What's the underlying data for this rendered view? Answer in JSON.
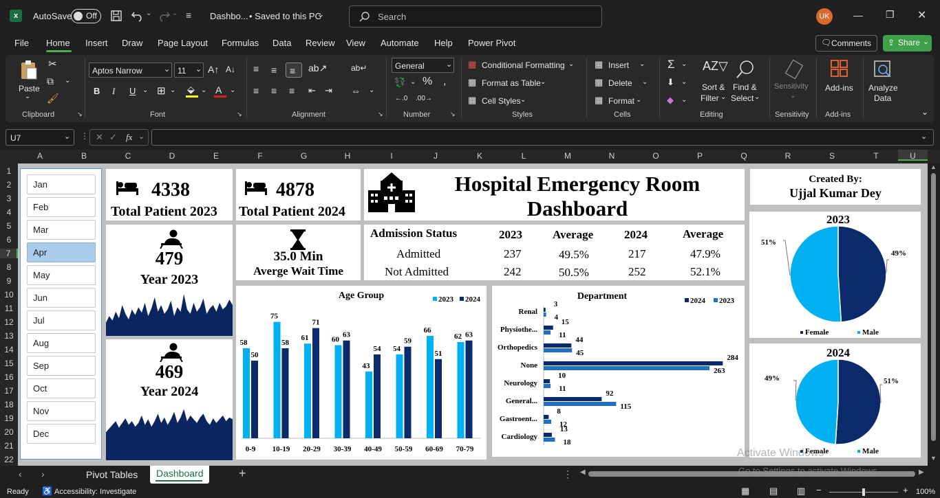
{
  "titlebar": {
    "autosave": "AutoSave",
    "toggle": "Off",
    "filename": "Dashbo...",
    "saved": "• Saved to this PC",
    "search_placeholder": "Search",
    "user": "UK"
  },
  "tabs": [
    "File",
    "Home",
    "Insert",
    "Draw",
    "Page Layout",
    "Formulas",
    "Data",
    "Review",
    "View",
    "Automate",
    "Help",
    "Power Pivot"
  ],
  "actions": {
    "comments": "Comments",
    "share": "Share"
  },
  "ribbon": {
    "paste": "Paste",
    "clipboard": "Clipboard",
    "font_name": "Aptos Narrow",
    "font_size": "11",
    "font": "Font",
    "alignment": "Alignment",
    "number_format": "General",
    "number": "Number",
    "cond_format": "Conditional Formatting",
    "format_table": "Format as Table",
    "cell_styles": "Cell Styles",
    "styles": "Styles",
    "insert": "Insert",
    "delete": "Delete",
    "format": "Format",
    "cells": "Cells",
    "sort_filter": "Sort &",
    "sort_filter2": "Filter",
    "find_select": "Find &",
    "find_select2": "Select",
    "editing": "Editing",
    "sensitivity": "Sensitivity",
    "sensitivity_grp": "Sensitivity",
    "addins": "Add-ins",
    "addins_grp": "Add-ins",
    "analyze": "Analyze",
    "analyze2": "Data"
  },
  "formula_bar": {
    "name_box": "U7",
    "fx": "fx",
    "formula": ""
  },
  "columns": [
    "A",
    "B",
    "C",
    "D",
    "E",
    "F",
    "G",
    "H",
    "I",
    "J",
    "K",
    "L",
    "M",
    "N",
    "O",
    "P",
    "Q",
    "R",
    "S",
    "T",
    "U"
  ],
  "rows": [
    "1",
    "2",
    "3",
    "4",
    "5",
    "6",
    "7",
    "8",
    "9",
    "10",
    "11",
    "12",
    "13",
    "14",
    "15",
    "16",
    "17",
    "18",
    "19",
    "20",
    "21",
    "22"
  ],
  "months": [
    "Jan",
    "Feb",
    "Mar",
    "Apr",
    "May",
    "Jun",
    "Jul",
    "Aug",
    "Sep",
    "Oct",
    "Nov",
    "Dec"
  ],
  "selected_month": "Apr",
  "kpi": {
    "p2023_value": "4338",
    "p2023_label": "Total Patient 2023",
    "p2024_value": "4878",
    "p2024_label": "Total Patient 2024",
    "wait_value": "35.0 Min",
    "wait_label": "Averge Wait Time",
    "y2023_value": "479",
    "y2023_label": "Year 2023",
    "y2024_value": "469",
    "y2024_label": "Year 2024"
  },
  "title": {
    "line1": "Hospital Emergency Room",
    "line2": "Dashboard"
  },
  "creator": {
    "line1": "Created By:",
    "line2": "Ujjal Kumar Dey"
  },
  "admission": {
    "headers": [
      "Admission Status",
      "2023",
      "Average",
      "2024",
      "Average"
    ],
    "rows": [
      [
        "Admitted",
        "237",
        "49.5%",
        "217",
        "47.9%"
      ],
      [
        "Not Admitted",
        "242",
        "50.5%",
        "252",
        "52.1%"
      ]
    ]
  },
  "sheet_tabs": [
    "Pivot Tables",
    "Dashboard"
  ],
  "active_sheet": "Dashboard",
  "status": {
    "ready": "Ready",
    "accessibility": "Accessibility: Investigate",
    "zoom": "100%"
  },
  "watermark": {
    "line1": "Activate Windows",
    "line2": "Go to Settings to activate Windows."
  },
  "colors": {
    "dark": "#0b2a6b",
    "light": "#00b0f0",
    "mid": "#1f6fc5",
    "selected": "#a9cdea",
    "share": "#4caf50"
  },
  "chart_data": [
    {
      "type": "bar",
      "title": "Age Group",
      "categories": [
        "0-9",
        "10-19",
        "20-29",
        "30-39",
        "40-49",
        "50-59",
        "60-69",
        "70-79"
      ],
      "series": [
        {
          "name": "2023",
          "values": [
            58,
            75,
            61,
            60,
            43,
            54,
            66,
            62
          ]
        },
        {
          "name": "2024",
          "values": [
            50,
            58,
            71,
            63,
            54,
            59,
            51,
            63
          ]
        }
      ],
      "ylim": [
        0,
        85
      ]
    },
    {
      "type": "bar",
      "orientation": "horizontal",
      "title": "Department",
      "categories": [
        "Renal",
        "Physiothe...",
        "Orthopedics",
        "None",
        "Neurology",
        "General...",
        "Gastroent...",
        "Cardiology"
      ],
      "series": [
        {
          "name": "2024",
          "values": [
            3,
            15,
            44,
            284,
            10,
            92,
            8,
            13
          ]
        },
        {
          "name": "2023",
          "values": [
            4,
            11,
            45,
            263,
            11,
            115,
            12,
            18
          ]
        }
      ],
      "xlim": [
        0,
        300
      ]
    },
    {
      "type": "pie",
      "title": "2023",
      "labels": [
        "Female",
        "Male"
      ],
      "values": [
        49,
        51
      ],
      "display": [
        "49%",
        "51%"
      ]
    },
    {
      "type": "pie",
      "title": "2024",
      "labels": [
        "Female",
        "Male"
      ],
      "values": [
        51,
        49
      ],
      "display": [
        "51%",
        "49%"
      ]
    },
    {
      "type": "area",
      "title": "",
      "series": [
        {
          "name": "Year 2023",
          "values": [
            12,
            18,
            14,
            22,
            16,
            28,
            20,
            15,
            24,
            19,
            26,
            21,
            30,
            18,
            25,
            35,
            22,
            28,
            20,
            24,
            32,
            18,
            26,
            22,
            38,
            24,
            20,
            30,
            22,
            26,
            34,
            20,
            25,
            28,
            22,
            30,
            24,
            27,
            33,
            28
          ]
        }
      ]
    },
    {
      "type": "area",
      "title": "",
      "series": [
        {
          "name": "Year 2024",
          "values": [
            30,
            34,
            38,
            42,
            35,
            40,
            45,
            38,
            42,
            36,
            40,
            48,
            38,
            44,
            36,
            42,
            50,
            40,
            46,
            38,
            44,
            52,
            40,
            46,
            55,
            42,
            48,
            44,
            40,
            46,
            50,
            42,
            38,
            45,
            40,
            44,
            48,
            42,
            46,
            44
          ]
        }
      ]
    }
  ]
}
